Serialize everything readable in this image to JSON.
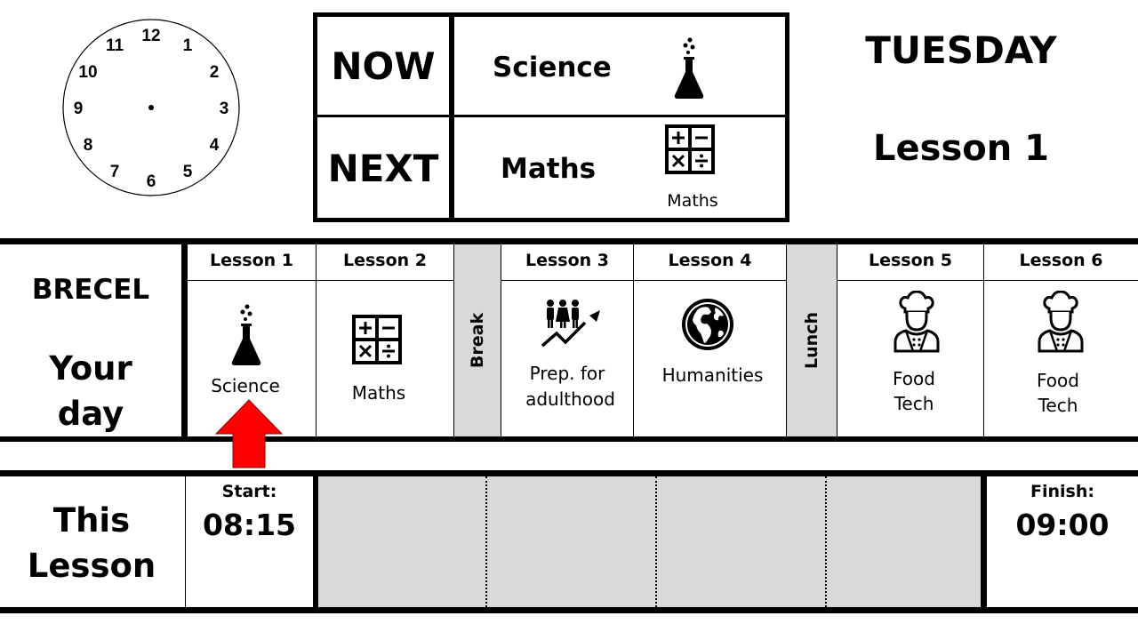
{
  "clock": {
    "numbers": [
      "12",
      "1",
      "2",
      "3",
      "4",
      "5",
      "6",
      "7",
      "8",
      "9",
      "10",
      "11"
    ]
  },
  "now_next": {
    "now_label": "NOW",
    "now_subject": "Science",
    "next_label": "NEXT",
    "next_subject": "Maths",
    "next_icon_caption": "Maths",
    "now_icon": "flask-icon",
    "next_icon": "maths-operators-icon"
  },
  "day": {
    "weekday": "TUESDAY",
    "current_lesson": "Lesson 1"
  },
  "schedule": {
    "student_name": "BRECEL",
    "your_day_line1": "Your",
    "your_day_line2": "day",
    "break_label": "Break",
    "lunch_label": "Lunch",
    "lessons": [
      {
        "header": "Lesson 1",
        "subject": "Science",
        "icon": "flask-icon"
      },
      {
        "header": "Lesson 2",
        "subject": "Maths",
        "icon": "maths-operators-icon"
      },
      {
        "header": "Lesson 3",
        "subject_line1": "Prep. for",
        "subject_line2": "adulthood",
        "icon": "people-growth-icon"
      },
      {
        "header": "Lesson 4",
        "subject": "Humanities",
        "icon": "globe-icon"
      },
      {
        "header": "Lesson 5",
        "subject_line1": "Food",
        "subject_line2": "Tech",
        "icon": "chef-icon"
      },
      {
        "header": "Lesson 6",
        "subject_line1": "Food",
        "subject_line2": "Tech",
        "icon": "chef-icon"
      }
    ],
    "pointer_color": "#ff0000",
    "pointer_icon": "up-arrow-icon"
  },
  "this_lesson": {
    "title_line1": "This",
    "title_line2": "Lesson",
    "start_label": "Start:",
    "start_time": "08:15",
    "finish_label": "Finish:",
    "finish_time": "09:00"
  }
}
